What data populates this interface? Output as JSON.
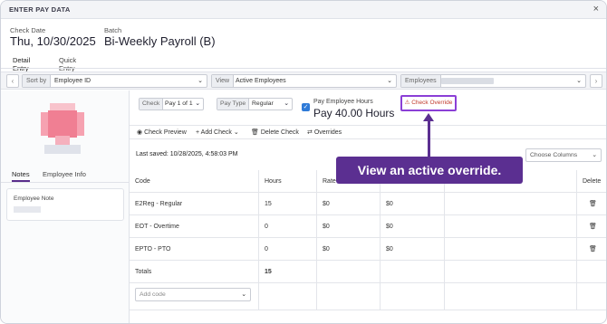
{
  "window": {
    "title": "ENTER PAY DATA",
    "close": "×"
  },
  "header": {
    "check_date_label": "Check Date",
    "check_date": "Thu, 10/30/2025",
    "batch_label": "Batch",
    "batch": "Bi-Weekly Payroll (B)"
  },
  "tabs": [
    "Detail Entry",
    "Quick Entry"
  ],
  "toolbar": {
    "prev": "‹",
    "next": "›",
    "sort_label": "Sort by",
    "sort_value": "Employee ID",
    "view_label": "View",
    "view_value": "Active Employees",
    "employees_label": "Employees"
  },
  "left": {
    "tabs": [
      "Notes",
      "Employee Info"
    ],
    "note_title": "Employee Note"
  },
  "check": {
    "check_label": "Check",
    "check_value": "Pay 1 of 1",
    "pay_type_label": "Pay Type",
    "pay_type_value": "Regular",
    "pay_hours_label": "Pay Employee Hours",
    "pay_hours_value": "Pay 40.00 Hours",
    "override_label": "Check Override"
  },
  "actions": {
    "preview": "Check Preview",
    "add": "Add Check",
    "delete": "Delete Check",
    "overrides": "Overrides"
  },
  "saved_text": "Last saved: 10/28/2025, 4:58:03 PM",
  "choose_columns": "Choose Columns",
  "table": {
    "headers": [
      "Code",
      "Hours",
      "Rate",
      "",
      "",
      "Delete"
    ],
    "rows": [
      [
        "E2Reg - Regular",
        "15",
        "$0",
        "$0"
      ],
      [
        "EOT - Overtime",
        "0",
        "$0",
        "$0"
      ],
      [
        "EPTO - PTO",
        "0",
        "$0",
        "$0"
      ]
    ],
    "totals_label": "Totals",
    "totals_hours": "15",
    "add_code_placeholder": "Add code"
  },
  "callout": "View an active override.",
  "colors": {
    "accent": "#5b2f91",
    "override_border": "#8b3fd6",
    "override_text": "#c0392b",
    "checkbox": "#2f7bd8",
    "trash": "#e05252"
  }
}
